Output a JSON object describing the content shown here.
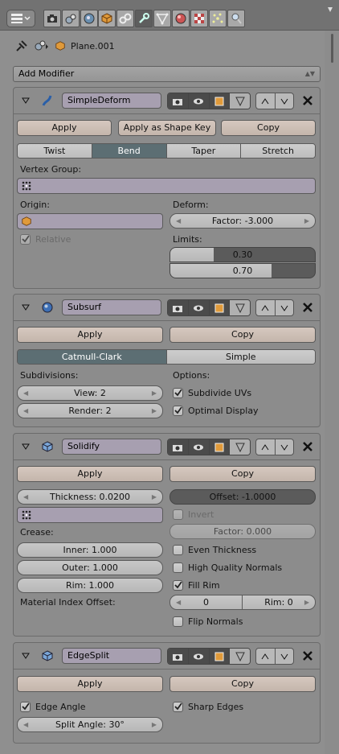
{
  "header": {
    "tabs": [
      "render-tab",
      "render-layers-tab",
      "scene-tab",
      "world-tab",
      "object-tab",
      "constraints-tab",
      "modifiers-tab",
      "data-tab",
      "material-tab",
      "texture-tab",
      "particles-tab",
      "physics-tab"
    ]
  },
  "breadcrumb": {
    "object": "Plane.001"
  },
  "add_modifier": "Add Modifier",
  "simple_deform": {
    "name": "SimpleDeform",
    "apply": "Apply",
    "apply_shape": "Apply as Shape Key",
    "copy": "Copy",
    "modes": [
      "Twist",
      "Bend",
      "Taper",
      "Stretch"
    ],
    "selected_mode": "Bend",
    "vertex_group_label": "Vertex Group:",
    "origin_label": "Origin:",
    "deform_label": "Deform:",
    "factor": "Factor: -3.000",
    "relative": "Relative",
    "limits_label": "Limits:",
    "limit_low": "0.30",
    "limit_high": "0.70",
    "limit_low_value": 0.3,
    "limit_high_value": 0.7
  },
  "subsurf": {
    "name": "Subsurf",
    "apply": "Apply",
    "copy": "Copy",
    "types": [
      "Catmull-Clark",
      "Simple"
    ],
    "selected_type": "Catmull-Clark",
    "subdivisions_label": "Subdivisions:",
    "options_label": "Options:",
    "view": "View: 2",
    "render": "Render: 2",
    "subdivide_uvs": "Subdivide UVs",
    "optimal_display": "Optimal Display"
  },
  "solidify": {
    "name": "Solidify",
    "apply": "Apply",
    "copy": "Copy",
    "thickness": "Thickness: 0.0200",
    "offset": "Offset: -1.0000",
    "offset_value": -1.0,
    "invert": "Invert",
    "crease_label": "Crease:",
    "factor": "Factor: 0.000",
    "inner": "Inner: 1.000",
    "outer": "Outer: 1.000",
    "rim": "Rim: 1.000",
    "even_thickness": "Even Thickness",
    "high_quality_normals": "High Quality Normals",
    "fill_rim": "Fill Rim",
    "material_index_offset_label": "Material Index Offset:",
    "mat_index": "0",
    "mat_rim": "Rim: 0",
    "flip_normals": "Flip Normals"
  },
  "edgesplit": {
    "name": "EdgeSplit",
    "apply": "Apply",
    "copy": "Copy",
    "edge_angle": "Edge Angle",
    "sharp_edges": "Sharp Edges",
    "split_angle": "Split Angle: 30°"
  },
  "colors": {
    "accent": "#5c6e73",
    "name_field": "#a79fb0",
    "button": "#d0c2b8"
  }
}
